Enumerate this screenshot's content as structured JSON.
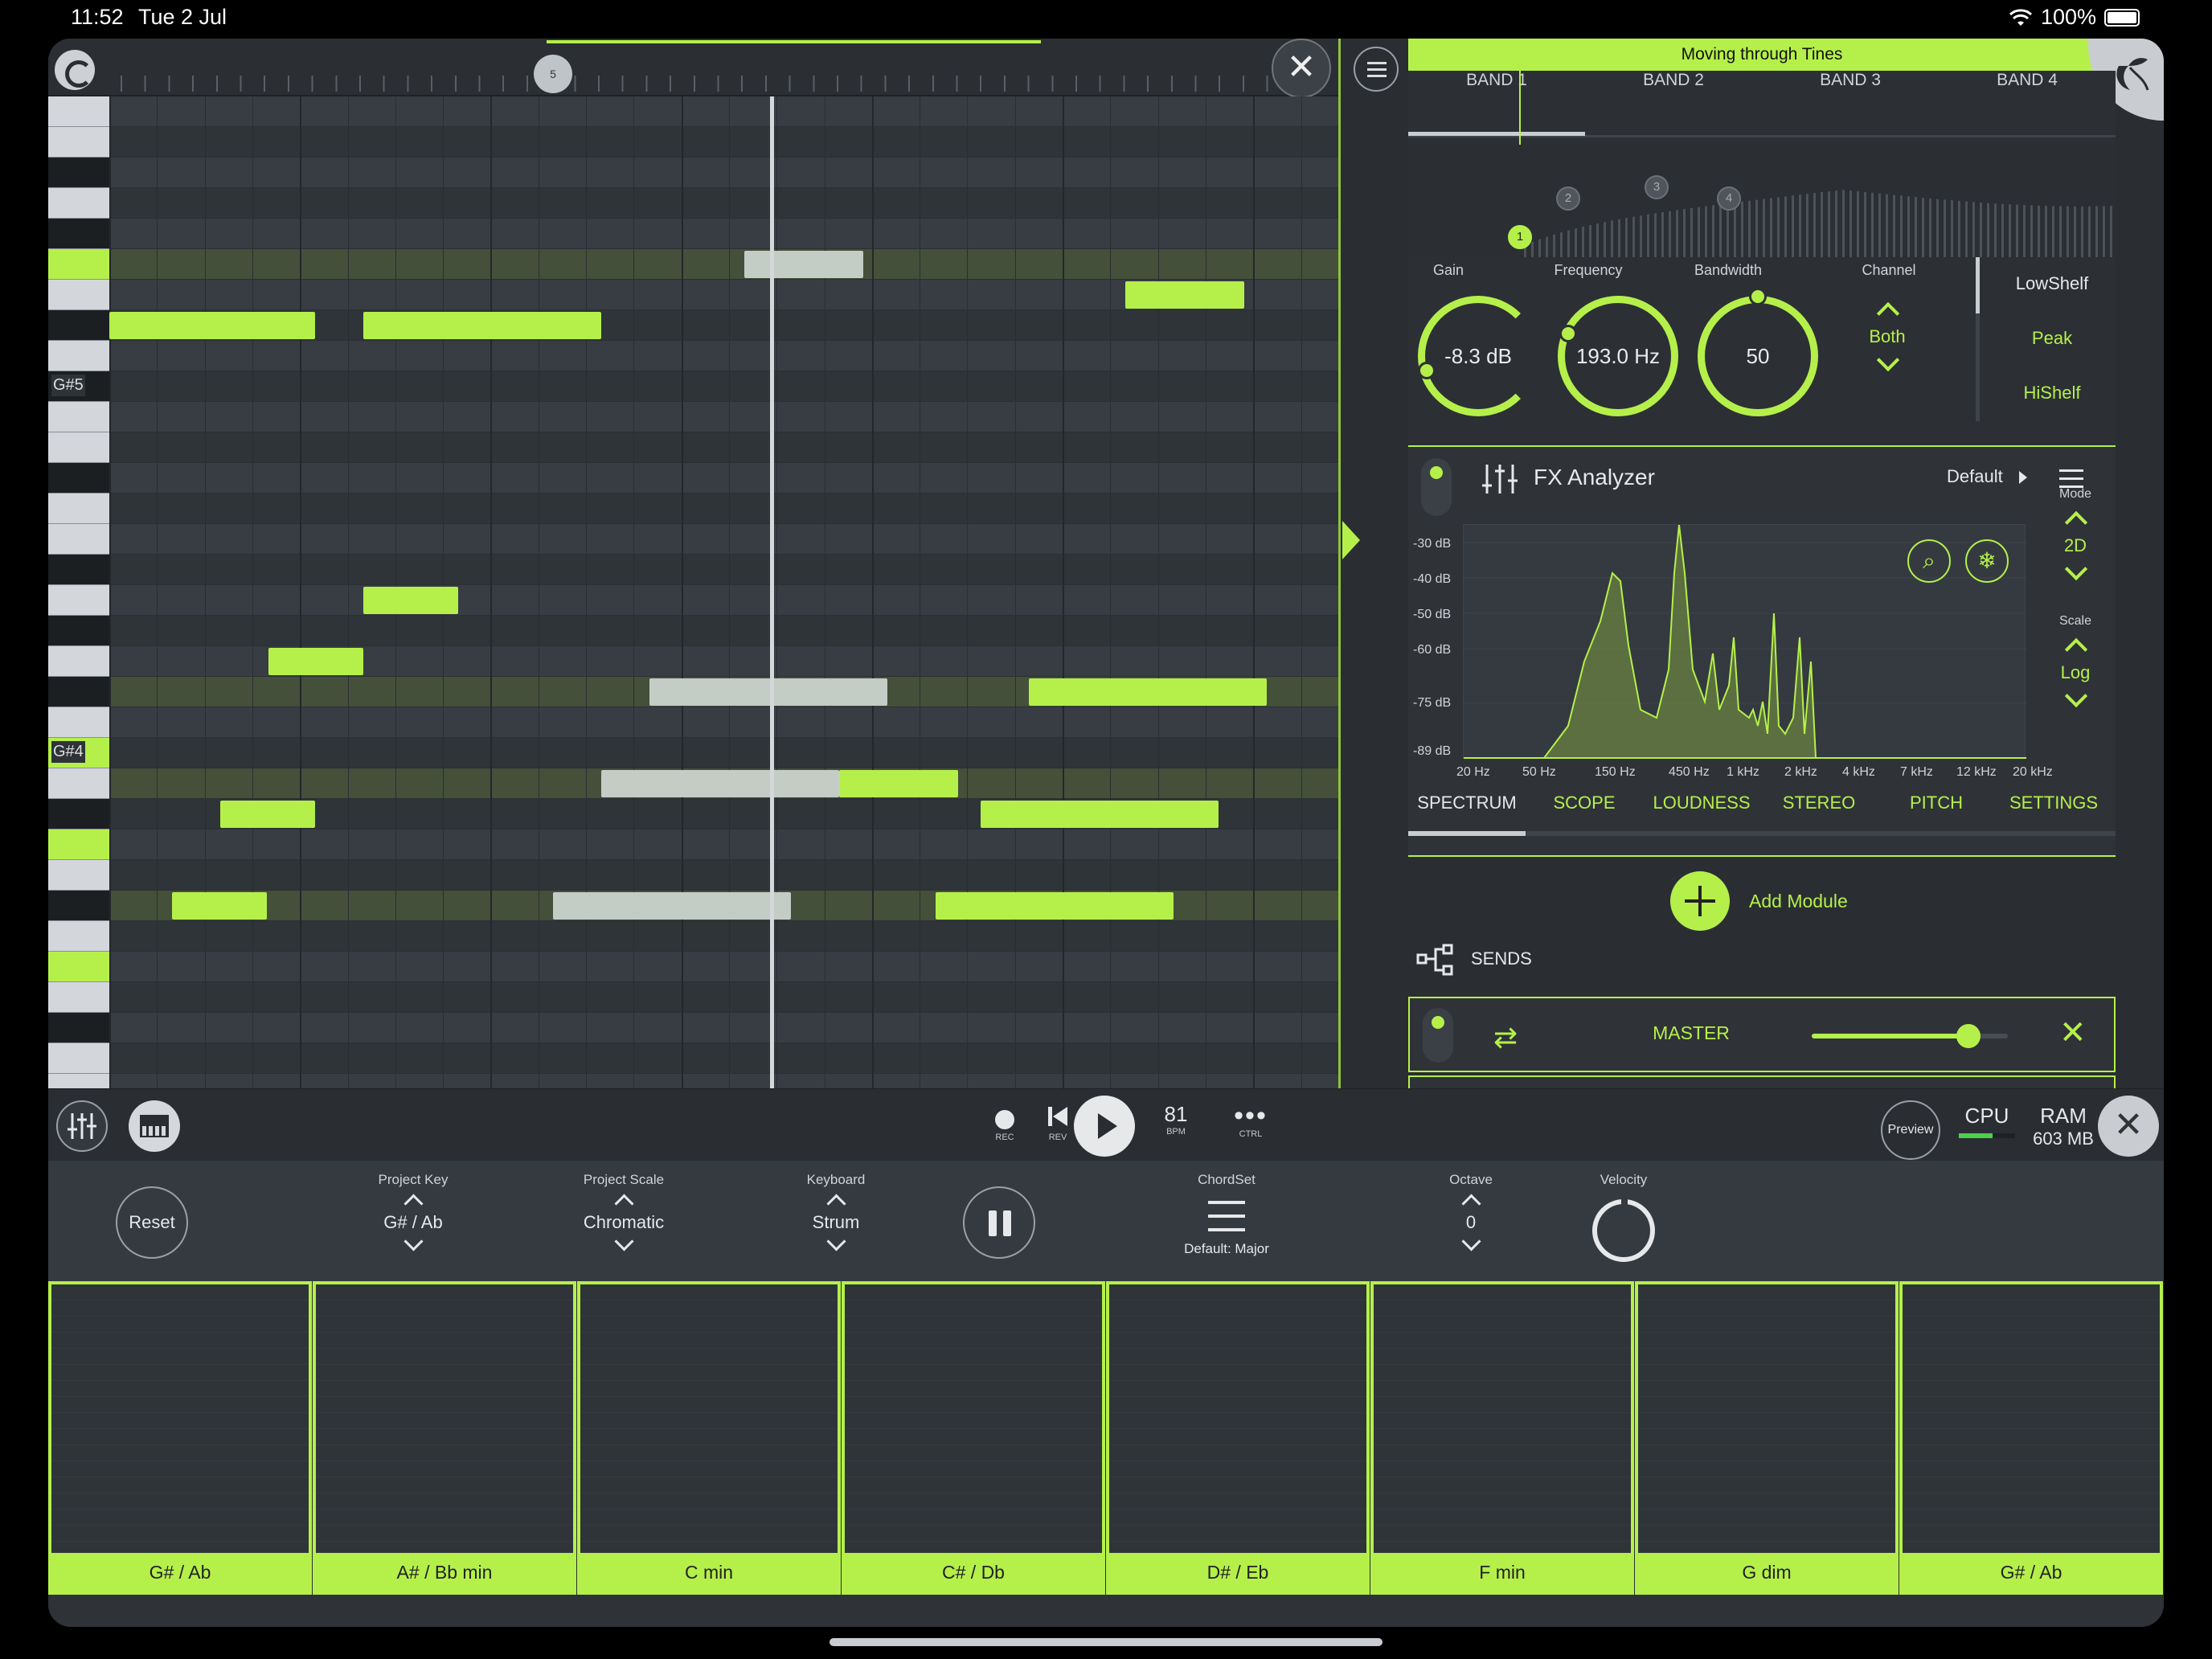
{
  "status": {
    "time": "11:52",
    "date": "Tue 2 Jul",
    "battery": "100%"
  },
  "roll": {
    "marker_label": "5",
    "key_labels": [
      "G#5",
      "G#4"
    ],
    "close_symbol": "✕"
  },
  "right_panel": {
    "song_title": "Moving through Tines",
    "bands": [
      "BAND 1",
      "BAND 2",
      "BAND 3",
      "BAND 4"
    ],
    "eq_nodes": [
      "1",
      "2",
      "3",
      "4"
    ],
    "knobs": [
      {
        "label": "Gain",
        "value": "-8.3 dB"
      },
      {
        "label": "Frequency",
        "value": "193.0 Hz"
      },
      {
        "label": "Bandwidth",
        "value": "50"
      }
    ],
    "channel": {
      "label": "Channel",
      "value": "Both"
    },
    "filter_types": [
      "LowShelf",
      "Peak",
      "HiShelf"
    ],
    "fx": {
      "title": "FX Analyzer",
      "preset": "Default",
      "y_labels": [
        "-30 dB",
        "-40 dB",
        "-50 dB",
        "-60 dB",
        "-75 dB",
        "-89 dB"
      ],
      "x_labels": [
        "20 Hz",
        "50 Hz",
        "150 Hz",
        "450 Hz",
        "1 kHz",
        "2 kHz",
        "4 kHz",
        "7 kHz",
        "12 kHz",
        "20 kHz"
      ],
      "mode": {
        "label": "Mode",
        "value": "2D"
      },
      "scale": {
        "label": "Scale",
        "value": "Log"
      },
      "tabs": [
        "SPECTRUM",
        "SCOPE",
        "LOUDNESS",
        "STEREO",
        "PITCH",
        "SETTINGS"
      ]
    },
    "add_module": "Add Module",
    "sends": "SENDS",
    "master": {
      "label": "MASTER",
      "level": 0.8
    }
  },
  "transport": {
    "rec": "REC",
    "rev": "REV",
    "bpm_value": "81",
    "bpm_label": "BPM",
    "ctrl_label": "CTRL",
    "ctrl_dots": "•••",
    "preview": "Preview",
    "cpu": "CPU",
    "cpu_level": 0.6,
    "ram": "RAM",
    "ram_value": "603 MB",
    "close_symbol": "✕"
  },
  "controls": {
    "reset": "Reset",
    "project_key": {
      "label": "Project Key",
      "value": "G# / Ab"
    },
    "project_scale": {
      "label": "Project Scale",
      "value": "Chromatic"
    },
    "keyboard": {
      "label": "Keyboard",
      "value": "Strum"
    },
    "chordset": {
      "label": "ChordSet",
      "value": "Default: Major"
    },
    "octave": {
      "label": "Octave",
      "value": "0"
    },
    "velocity": {
      "label": "Velocity"
    }
  },
  "chords": [
    "G# / Ab",
    "A# / Bb min",
    "C min",
    "C# / Db",
    "D# / Eb",
    "F min",
    "G dim",
    "G# / Ab"
  ],
  "colors": {
    "accent": "#b5f04a",
    "panel": "#2a2e33"
  }
}
